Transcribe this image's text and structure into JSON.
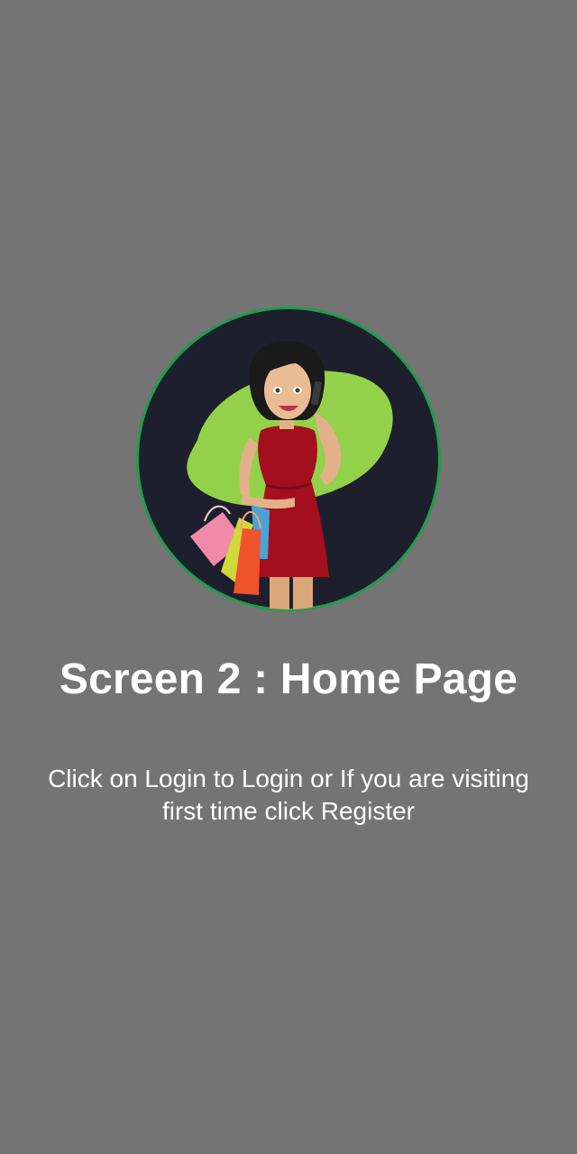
{
  "screen": {
    "title": "Screen 2 : Home Page",
    "message": "Click on Login to Login or If you are visiting first time click Register"
  },
  "logo": {
    "icon": "shopping-woman-logo",
    "colors": {
      "ring": "#1e9e4a",
      "background": "#1e1f2d",
      "blob": "#93d14b",
      "dress": "#a30f1c"
    }
  }
}
